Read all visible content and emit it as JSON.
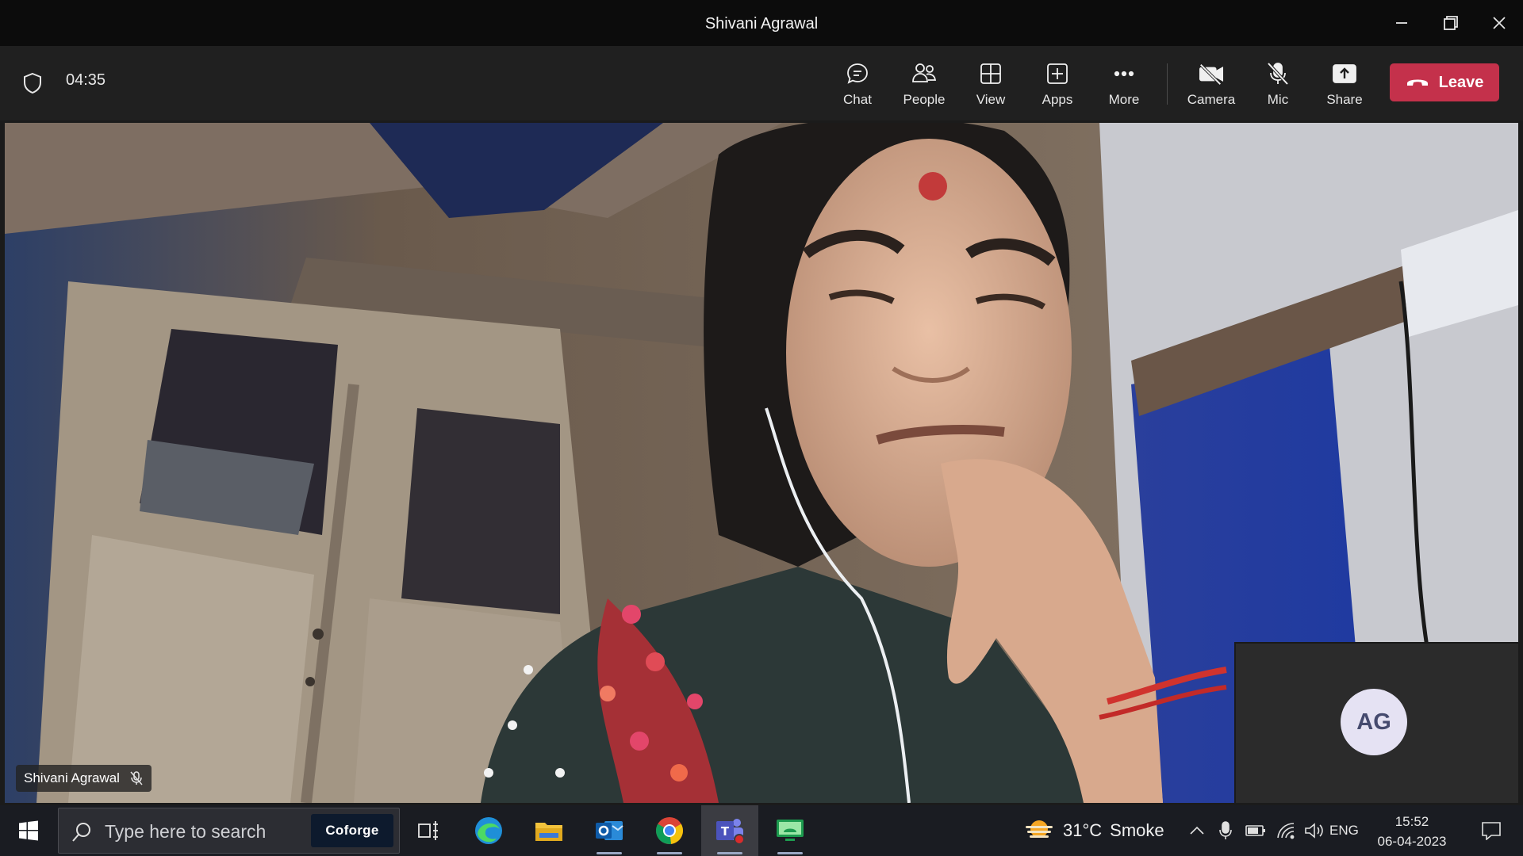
{
  "window": {
    "title": "Shivani Agrawal"
  },
  "meeting": {
    "timer": "04:35",
    "toolbar": [
      {
        "id": "chat",
        "label": "Chat",
        "icon": "chat-icon"
      },
      {
        "id": "people",
        "label": "People",
        "icon": "people-icon"
      },
      {
        "id": "view",
        "label": "View",
        "icon": "view-icon"
      },
      {
        "id": "apps",
        "label": "Apps",
        "icon": "apps-icon"
      },
      {
        "id": "more",
        "label": "More",
        "icon": "more-icon"
      },
      {
        "id": "camera",
        "label": "Camera",
        "icon": "camera-off-icon"
      },
      {
        "id": "mic",
        "label": "Mic",
        "icon": "mic-off-icon"
      },
      {
        "id": "share",
        "label": "Share",
        "icon": "share-icon"
      }
    ],
    "leave_label": "Leave",
    "leave_color": "#c4314b",
    "participant_name": "Shivani Agrawal",
    "participant_muted": true,
    "self_initials": "AG"
  },
  "taskbar": {
    "search_placeholder": "Type here to search",
    "search_brand": "Coforge",
    "apps": [
      "task-view-icon",
      "edge-icon",
      "file-explorer-icon",
      "outlook-icon",
      "chrome-icon",
      "teams-icon",
      "remote-desktop-icon"
    ],
    "active_app": "teams-icon",
    "weather": {
      "temp": "31°C",
      "condition": "Smoke"
    },
    "language": "ENG",
    "time": "15:52",
    "date": "06-04-2023"
  }
}
